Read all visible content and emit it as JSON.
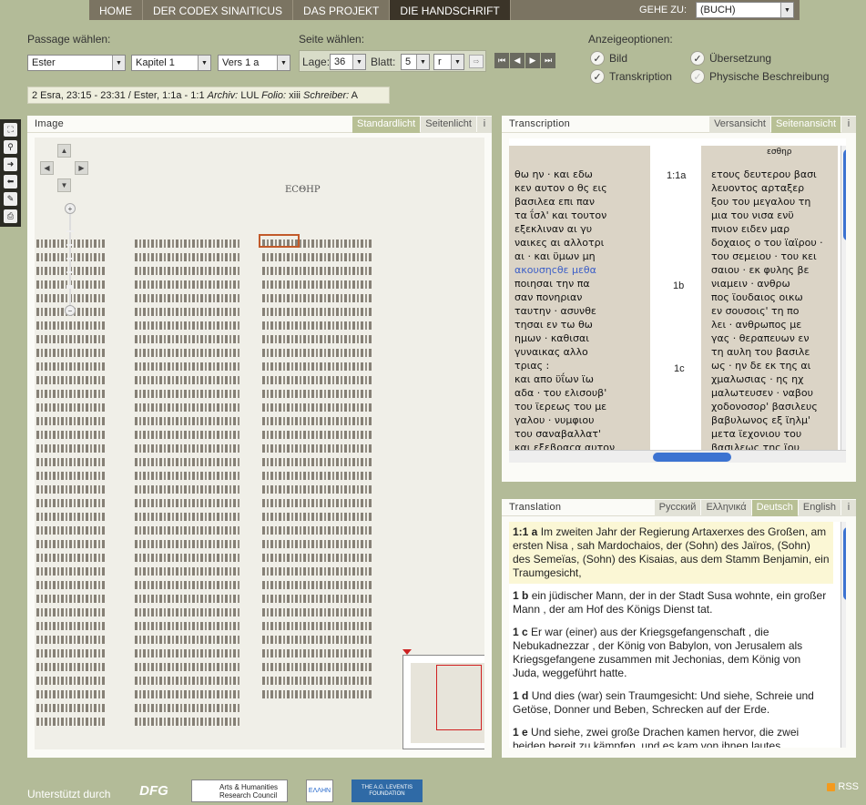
{
  "nav": {
    "items": [
      "HOME",
      "DER CODEX SINAITICUS",
      "DAS PROJEKT",
      "DIE HANDSCHRIFT"
    ],
    "active_index": 3,
    "goto_label": "GEHE ZU:",
    "goto_value": "(BUCH)"
  },
  "passage": {
    "label": "Passage wählen:",
    "book": "Ester",
    "chapter": "Kapitel 1",
    "verse": "Vers 1 a"
  },
  "page_select": {
    "label": "Seite wählen:",
    "lage_label": "Lage:",
    "lage_value": "36",
    "blatt_label": "Blatt:",
    "blatt_value": "5",
    "side_value": "r"
  },
  "display_options": {
    "label": "Anzeigeoptionen:",
    "bild": "Bild",
    "transkription": "Transkription",
    "uebersetzung": "Übersetzung",
    "physische": "Physische Beschreibung"
  },
  "status": {
    "range": "2 Esra, 23:15 - 23:31 / Ester, 1:1a - 1:1",
    "archiv_label": "Archiv:",
    "archiv_value": "LUL",
    "folio_label": "Folio:",
    "folio_value": "xiii",
    "schreiber_label": "Schreiber:",
    "schreiber_value": "A"
  },
  "image_panel": {
    "title": "Image",
    "tab_standard": "Standardlicht",
    "tab_seiten": "Seitenlicht",
    "info": "i",
    "heading": "ΕϹΘΗΡ"
  },
  "transcription_panel": {
    "title": "Transcription",
    "tab_vers": "Versansicht",
    "tab_seiten": "Seitenansicht",
    "info": "i",
    "col2_heading": "εσθηρ",
    "col1": [
      "θω ην · και εδω",
      "κεν αυτον ο θς εις",
      "βασιλεα επι παν",
      "τα ΐσλ' και τουτον",
      "εξεκλιναν αι γυ",
      "ναικες αι αλλοτρι",
      "αι · και ϋμων μη",
      "ακουσηcθε μεθα",
      "ποιησαι την πα",
      "σαν πονηριαν",
      "ταυτην · ασυνθε",
      "τησαι εν τω θω",
      "ημων · καθισαι",
      "γυναικας αλλο",
      "τριας :",
      "και απο ϋΐων ϊω",
      "αδα · του ελισουβ'",
      "του ϊερεως του με",
      "γαλου · νυμφιου",
      "του σαναβαλλατ'",
      "και εξεβραcα αυτον"
    ],
    "verse_nums": [
      "1:1a",
      "1b",
      "1c"
    ],
    "col2": [
      "ετους δευτερου βασι",
      "λευοντος αρταξερ",
      "ξου του μεγαλου τη",
      "μια του νισα ενϋ",
      "πνιον ειδεν μαρ",
      "δοχαιος ο του ϊαϊρου ·",
      "του σεμειου · του κει",
      "σαιου · εκ φυλης βε",
      "νιαμειν · ανθρω",
      "πος ϊουδαιος οικω",
      "εν σουσοις' τη πο",
      "λει · ανθρωπος με",
      "γας · θεραπευων εν",
      "τη αυλη του βασιλε",
      "ως · ην δε εκ της αι",
      "χμαλωσιας · ης ηχ",
      "μαλωτευσεν · ναβου",
      "χοδονοσορ' βασιλευς",
      "βαβυλωνος εξ ϊηλμ'",
      "μετα ϊεχονιου του",
      "βασιλεως της ϊου"
    ]
  },
  "translation_panel": {
    "title": "Translation",
    "tabs": [
      "Русский",
      "Ελληνικά",
      "Deutsch",
      "English"
    ],
    "active_tab": "Deutsch",
    "info": "i",
    "paragraphs": [
      {
        "ref": "1:1 a",
        "text": "Im zweiten Jahr der Regierung Artaxerxes des Großen, am ersten Nisa , sah Mardochaios, der (Sohn) des Jaïros, (Sohn) des Semeïas, (Sohn) des Kisaias, aus dem Stamm Benjamin, ein Traumgesicht,"
      },
      {
        "ref": "1 b",
        "text": "ein jüdischer Mann, der in der Stadt Susa wohnte, ein großer Mann , der am Hof des Königs Dienst tat."
      },
      {
        "ref": "1 c",
        "text": "Er war (einer) aus der Kriegsgefangenschaft , die Nebukadnezzar , der König von Babylon, von Jerusalem als Kriegsgefangene zusammen mit Jechonias, dem König von Juda, weggeführt hatte."
      },
      {
        "ref": "1 d",
        "text": "Und dies (war) sein Traumgesicht: Und siehe, Schreie und Getöse, Donner und Beben, Schrecken auf der Erde."
      },
      {
        "ref": "1 e",
        "text": "Und siehe, zwei große Drachen kamen hervor, die zwei beiden bereit zu kämpfen, und es kam von ihnen lautes"
      }
    ]
  },
  "footer": {
    "supported_by": "Unterstützt durch",
    "logos": [
      "DFG",
      "Arts & Humanities Research Council",
      "ΕΛΛΗΝ",
      "THE A.G. LEVENTIS FOUNDATION"
    ],
    "rss": "RSS"
  }
}
